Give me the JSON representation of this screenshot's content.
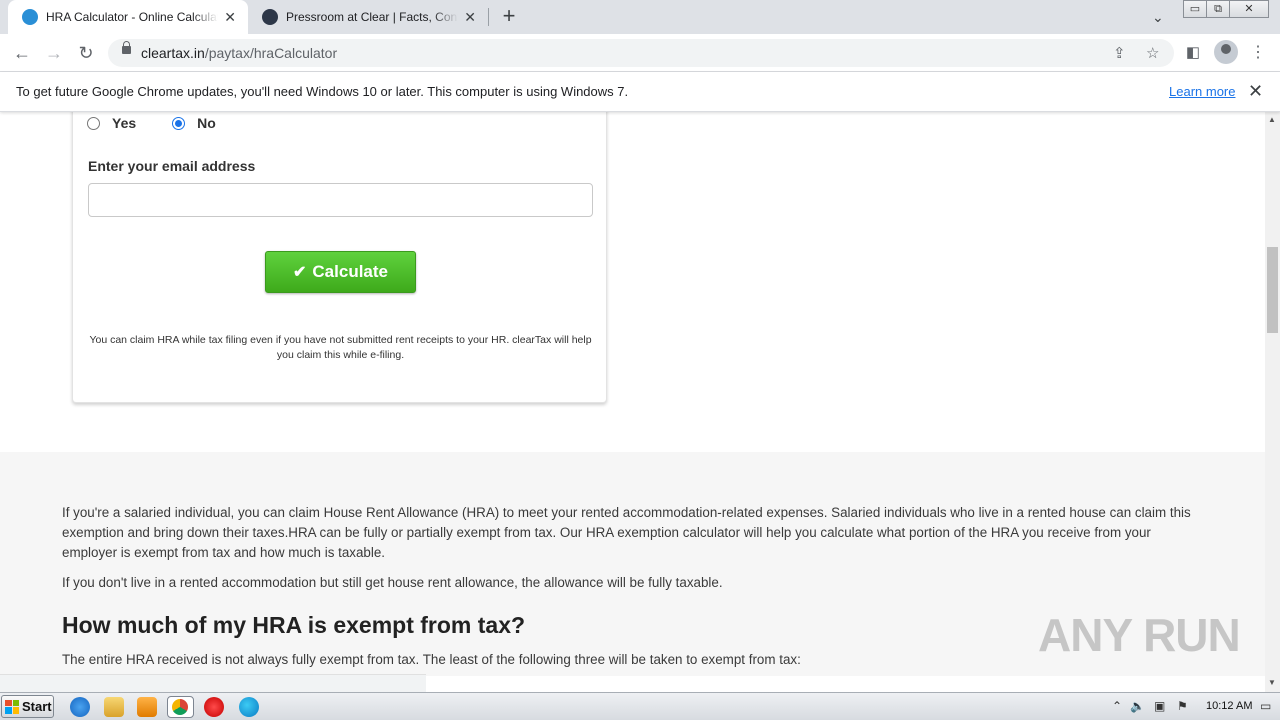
{
  "browser": {
    "tabs": [
      {
        "title": "HRA Calculator - Online Calculate your House Rent Allowance",
        "active": true,
        "favicon_color": "#2a8fd6"
      },
      {
        "title": "Pressroom at Clear | Facts, Contact Information",
        "active": false,
        "favicon_color": "#2d3748"
      }
    ],
    "url_host": "cleartax.in",
    "url_path": "/paytax/hraCalculator",
    "window_controls": {
      "minimize": "▭",
      "restore": "⧉",
      "close": "✕"
    }
  },
  "infobar": {
    "message": "To get future Google Chrome updates, you'll need Windows 10 or later. This computer is using Windows 7.",
    "link": "Learn more"
  },
  "form": {
    "radio_yes": "Yes",
    "radio_no": "No",
    "radio_selected": "No",
    "email_label": "Enter your email address",
    "email_value": "",
    "calculate_label": "Calculate",
    "note": "You can claim HRA while tax filing even if you have not submitted rent receipts to your HR. clearTax will help you claim this while e-filing."
  },
  "article": {
    "para1": "If you're a salaried individual, you can claim House Rent Allowance (HRA) to meet your rented accommodation-related expenses. Salaried individuals who live in a rented house can claim this exemption and bring down their taxes.HRA can be fully or partially exempt from tax. Our HRA exemption calculator will help you calculate what portion of the HRA you receive from your employer is exempt from tax and how much is taxable.",
    "para2": "If you don't live in a rented accommodation but still get house rent allowance, the allowance will be fully taxable.",
    "heading": "How much of my HRA is exempt from tax?",
    "para3": "The entire HRA received is not always fully exempt from tax. The least of the following three will be taken to exempt from tax:"
  },
  "watermark": "ANY RUN",
  "taskbar": {
    "start_label": "Start",
    "clock": "10:12 AM"
  },
  "colors": {
    "calculate_green": "#4cbf26",
    "link_blue": "#1a73e8",
    "article_bg": "#f6f6f6"
  }
}
